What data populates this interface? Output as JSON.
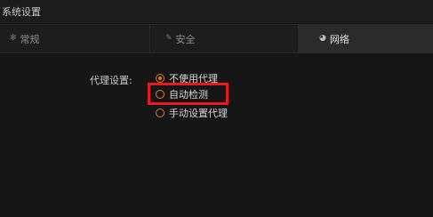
{
  "window": {
    "title": "系统设置"
  },
  "tabs": [
    {
      "label": "常规",
      "icon": "gear-icon",
      "glyph": "✻",
      "active": false
    },
    {
      "label": "安全",
      "icon": "security-icon",
      "glyph": "✎",
      "active": false
    },
    {
      "label": "网络",
      "icon": "network-icon",
      "glyph": "◕",
      "active": true
    }
  ],
  "proxy": {
    "label": "代理设置:",
    "options": [
      {
        "label": "不使用代理",
        "selected": true
      },
      {
        "label": "自动检测",
        "selected": false
      },
      {
        "label": "手动设置代理",
        "selected": false
      }
    ]
  },
  "colors": {
    "accent": "#e07a2e",
    "highlight": "#e8191f",
    "background": "#161616"
  }
}
